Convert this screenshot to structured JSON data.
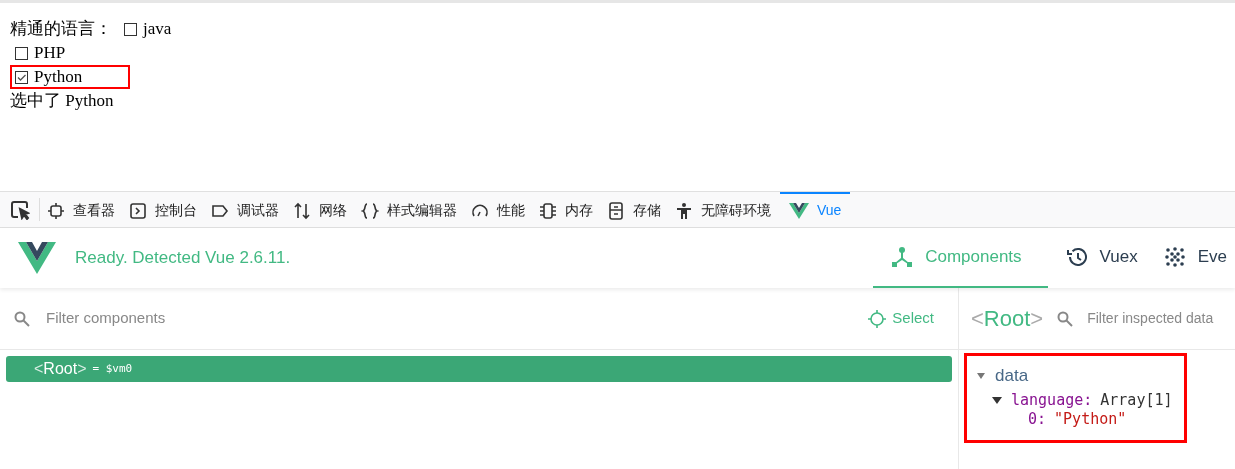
{
  "page": {
    "label": "精通的语言：",
    "options": [
      {
        "label": "java",
        "checked": false
      },
      {
        "label": "PHP",
        "checked": false
      },
      {
        "label": "Python",
        "checked": true,
        "highlighted": true
      }
    ],
    "result": "选中了 Python"
  },
  "devtools_tabs": [
    {
      "kind": "inspector",
      "label": "查看器",
      "selected": false
    },
    {
      "kind": "console",
      "label": "控制台",
      "selected": false
    },
    {
      "kind": "debugger",
      "label": "调试器",
      "selected": false
    },
    {
      "kind": "network",
      "label": "网络",
      "selected": false
    },
    {
      "kind": "style",
      "label": "样式编辑器",
      "selected": false
    },
    {
      "kind": "performance",
      "label": "性能",
      "selected": false
    },
    {
      "kind": "memory",
      "label": "内存",
      "selected": false
    },
    {
      "kind": "storage",
      "label": "存储",
      "selected": false
    },
    {
      "kind": "accessibility",
      "label": "无障碍环境",
      "selected": false
    },
    {
      "kind": "vue",
      "label": "Vue",
      "selected": true
    }
  ],
  "vue_header": {
    "status": "Ready. Detected Vue 2.6.11.",
    "tabs": [
      {
        "kind": "components",
        "label": "Components",
        "selected": true
      },
      {
        "kind": "vuex",
        "label": "Vuex",
        "selected": false
      },
      {
        "kind": "events",
        "label": "Eve",
        "selected": false
      }
    ]
  },
  "components_panel": {
    "filter": {
      "placeholder": "Filter components"
    },
    "select_label": "Select",
    "tree": [
      {
        "open_bracket": "<",
        "name": "Root",
        "close_bracket": ">",
        "ref": "= $vm0",
        "selected": true
      }
    ]
  },
  "inspector": {
    "open_bracket": "<",
    "name": "Root",
    "close_bracket": ">",
    "filter": {
      "placeholder": "Filter inspected data"
    },
    "highlighted": true,
    "sections": [
      {
        "label": "data",
        "expanded": true,
        "children": [
          {
            "key": "language:",
            "value": "Array[1]",
            "expanded": true,
            "children": [
              {
                "key": "0:",
                "value": "\"Python\""
              }
            ]
          }
        ]
      }
    ]
  }
}
